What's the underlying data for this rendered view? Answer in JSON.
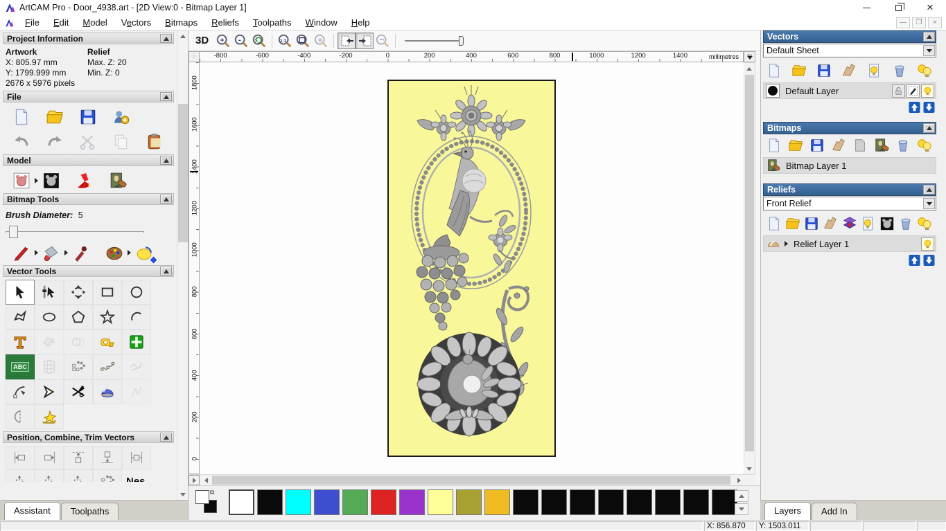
{
  "window": {
    "title": "ArtCAM Pro - Door_4938.art - [2D View:0 - Bitmap Layer 1]"
  },
  "menubar": {
    "items": [
      {
        "pre": "",
        "u": "F",
        "post": "ile"
      },
      {
        "pre": "",
        "u": "E",
        "post": "dit"
      },
      {
        "pre": "",
        "u": "M",
        "post": "odel"
      },
      {
        "pre": "V",
        "u": "e",
        "post": "ctors"
      },
      {
        "pre": "",
        "u": "B",
        "post": "itmaps"
      },
      {
        "pre": "",
        "u": "R",
        "post": "eliefs"
      },
      {
        "pre": "",
        "u": "T",
        "post": "oolpaths"
      },
      {
        "pre": "",
        "u": "W",
        "post": "indow"
      },
      {
        "pre": "",
        "u": "H",
        "post": "elp"
      }
    ]
  },
  "assistant": {
    "project": {
      "title": "Project Information",
      "artwork_heading": "Artwork",
      "relief_heading": "Relief",
      "artwork_x": "X: 805.97 mm",
      "artwork_y": "Y: 1799.999 mm",
      "artwork_pixels": "2676 x 5976 pixels",
      "relief_max": "Max. Z: 20",
      "relief_min": "Min. Z: 0"
    },
    "file": {
      "title": "File",
      "icons": [
        "new-model",
        "open-file",
        "save-model",
        "model-wizard",
        "undo",
        "redo",
        "cut",
        "copy",
        "paste"
      ]
    },
    "model": {
      "title": "Model",
      "icons": [
        "adjust-model",
        "invert-model",
        "light-material",
        "load-bitmap"
      ]
    },
    "bitmap_tools": {
      "title": "Bitmap Tools",
      "brush_label": "Brush Diameter:",
      "brush_value": "5",
      "icons": [
        "paint-brush",
        "flood-fill",
        "colour-picker",
        "palette",
        "texture-flood"
      ]
    },
    "vector_tools": {
      "title": "Vector Tools",
      "abc_label": "ABC",
      "tools": [
        "select-vectors",
        "node-editing",
        "transform-vectors",
        "create-rectangle",
        "create-circle",
        "create-polyline",
        "create-ellipse",
        "create-polygon",
        "create-star",
        "create-arc",
        "create-text",
        "offset-vectors",
        "weld-vectors",
        "measure",
        "block-paste",
        "abc-matrix",
        "envelope-distort",
        "block-copy-rotate",
        "fit-arcs",
        "freehand-smooth",
        "fillet-curve",
        "join-vectors",
        "trim-vectors",
        "vector-doctor",
        "bridge-nodes",
        "mirror-merge",
        "vector-texture"
      ]
    },
    "position": {
      "title": "Position, Combine, Trim Vectors",
      "icons": [
        "align-left",
        "align-right",
        "align-top",
        "align-bottom",
        "align-centre",
        "centre-in-page",
        "align-centre-vertical",
        "align-centre-horizontal",
        "block-nest"
      ],
      "nesting_label": "Nes"
    },
    "tabs": [
      {
        "label": "Assistant",
        "active": true
      },
      {
        "label": "Toolpaths",
        "active": false
      }
    ]
  },
  "canvas": {
    "toolbar": {
      "view_3d": "3D",
      "icons": [
        "zoom-in",
        "zoom-out",
        "zoom-previous",
        "zoom-1to1",
        "zoom-box",
        "zoom-object",
        "fit-page-left",
        "fit-page-right",
        "pan-view",
        "zoom-slider"
      ]
    },
    "ruler": {
      "h_ticks": [
        "-800",
        "-600",
        "-400",
        "-200",
        "0",
        "200",
        "400",
        "600",
        "800",
        "1000",
        "1200",
        "1400"
      ],
      "units": "millimetres",
      "v_ticks": [
        "1800",
        "1600",
        "1400",
        "1200",
        "1000",
        "800",
        "600",
        "400",
        "200",
        "0"
      ]
    },
    "artwork": {
      "background": "#f8f89a",
      "border": "#1a1a1a"
    }
  },
  "palette": {
    "primary": "#ffffff",
    "secondary": "#0a0a0a",
    "swatches": [
      "#ffffff",
      "#0a0a0a",
      "#00ffff",
      "#3d4fd0",
      "#55aa55",
      "#dd2222",
      "#9933cc",
      "#ffff99",
      "#a8a030",
      "#eebb22",
      "#0a0a0a",
      "#0a0a0a",
      "#0a0a0a",
      "#0a0a0a",
      "#0a0a0a",
      "#0a0a0a",
      "#0a0a0a",
      "#0a0a0a"
    ]
  },
  "layers_panel": {
    "vectors": {
      "title": "Vectors",
      "sheet": "Default Sheet",
      "toolbar": [
        "new-layer",
        "open-vectors",
        "save-vectors",
        "merge-layers",
        "toggle-visibility",
        "delete-layer",
        "show-all-layers"
      ],
      "layer": {
        "name": "Default Layer"
      }
    },
    "bitmaps": {
      "title": "Bitmaps",
      "toolbar": [
        "new-layer",
        "open-bitmap",
        "save-bitmap",
        "merge-layers",
        "copy-sheet",
        "bitmap-preview",
        "delete-layer",
        "show-all-layers"
      ],
      "layer": {
        "name": "Bitmap Layer 1"
      }
    },
    "reliefs": {
      "title": "Reliefs",
      "relief": "Front Relief",
      "toolbar": [
        "new-layer",
        "open-relief",
        "save-relief",
        "merge-layers",
        "combine-reliefs",
        "toggle-visibility",
        "calculate-relief",
        "delete-layer",
        "show-all-layers"
      ],
      "layer": {
        "name": "Relief Layer 1"
      }
    },
    "tabs": [
      {
        "label": "Layers",
        "active": true
      },
      {
        "label": "Add In",
        "active": false
      }
    ]
  },
  "statusbar": {
    "x": "X: 856.870",
    "y": "Y: 1503.011"
  }
}
